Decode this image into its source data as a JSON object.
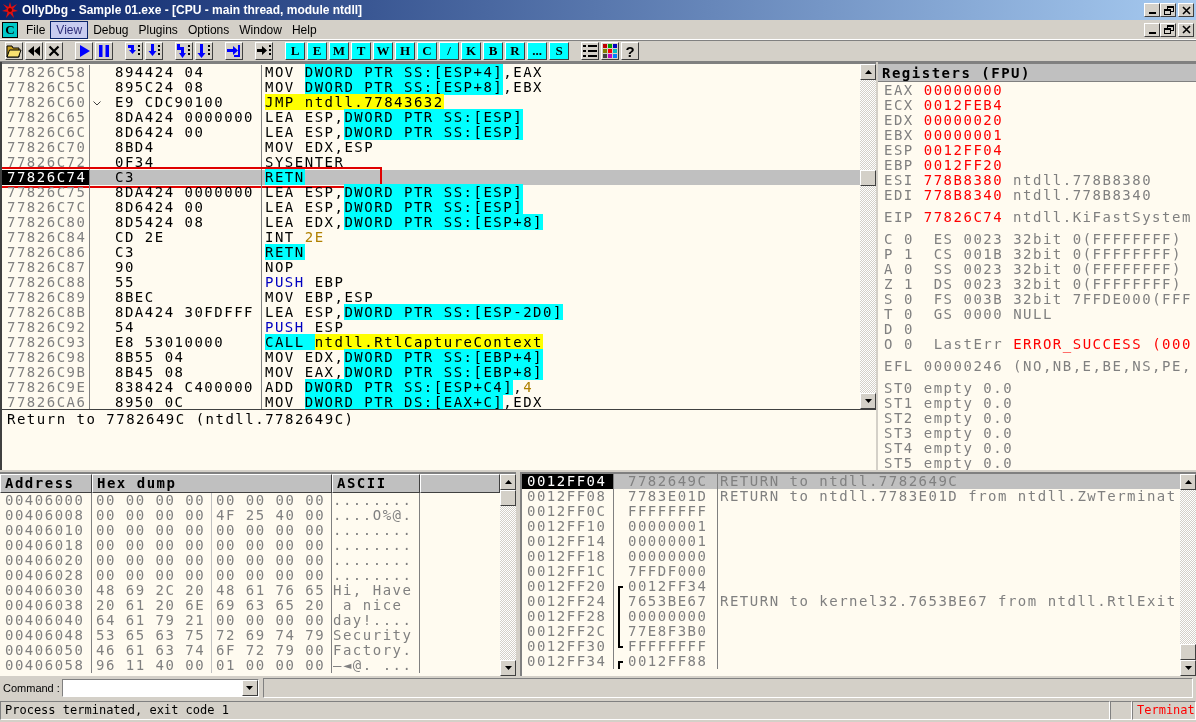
{
  "window": {
    "title": "OllyDbg - Sample 01.exe - [CPU - main thread, module ntdll]"
  },
  "menu": {
    "app_label": "C",
    "items": [
      {
        "label": "File",
        "selected": false
      },
      {
        "label": "View",
        "selected": true
      },
      {
        "label": "Debug",
        "selected": false
      },
      {
        "label": "Plugins",
        "selected": false
      },
      {
        "label": "Options",
        "selected": false
      },
      {
        "label": "Window",
        "selected": false
      },
      {
        "label": "Help",
        "selected": false
      }
    ]
  },
  "toolbar": [
    [
      {
        "kind": "open"
      },
      {
        "kind": "restart"
      },
      {
        "kind": "close"
      }
    ],
    [
      {
        "kind": "run"
      },
      {
        "kind": "pause"
      }
    ],
    [
      {
        "kind": "step_into"
      },
      {
        "kind": "step_over"
      }
    ],
    [
      {
        "kind": "trace_into"
      },
      {
        "kind": "trace_over"
      }
    ],
    [
      {
        "kind": "till_return"
      }
    ],
    [
      {
        "kind": "goto"
      }
    ],
    [
      {
        "kind": "letter",
        "label": "L"
      },
      {
        "kind": "letter",
        "label": "E"
      },
      {
        "kind": "letter",
        "label": "M"
      },
      {
        "kind": "letter",
        "label": "T"
      },
      {
        "kind": "letter",
        "label": "W"
      },
      {
        "kind": "letter",
        "label": "H"
      },
      {
        "kind": "letter",
        "label": "C"
      },
      {
        "kind": "letter",
        "label": "/"
      },
      {
        "kind": "letter",
        "label": "K"
      },
      {
        "kind": "letter",
        "label": "B"
      },
      {
        "kind": "letter",
        "label": "R"
      },
      {
        "kind": "letter",
        "label": "..."
      },
      {
        "kind": "letter",
        "label": "S"
      }
    ],
    [
      {
        "kind": "list"
      },
      {
        "kind": "colors"
      },
      {
        "kind": "help",
        "label": "?"
      }
    ]
  ],
  "disassembly": {
    "rows": [
      {
        "address": "77826C58",
        "hex": "894424 04",
        "jump": false,
        "selected": false,
        "outlined": false,
        "code": [
          {
            "text": "MOV ",
            "kind": "plain"
          },
          {
            "text": "DWORD PTR SS:[ESP+4]",
            "kind": "mem"
          },
          {
            "text": ",EAX",
            "kind": "plain"
          }
        ]
      },
      {
        "address": "77826C5C",
        "hex": "895C24 08",
        "jump": false,
        "selected": false,
        "outlined": false,
        "code": [
          {
            "text": "MOV ",
            "kind": "plain"
          },
          {
            "text": "DWORD PTR SS:[ESP+8]",
            "kind": "mem"
          },
          {
            "text": ",EBX",
            "kind": "plain"
          }
        ]
      },
      {
        "address": "77826C60",
        "hex": "E9 CDC90100",
        "jump": true,
        "selected": false,
        "outlined": false,
        "code": [
          {
            "text": "JMP ntdll.77843632",
            "kind": "target"
          }
        ]
      },
      {
        "address": "77826C65",
        "hex": "8DA424 0000000",
        "jump": false,
        "selected": false,
        "outlined": false,
        "code": [
          {
            "text": "LEA ESP,",
            "kind": "plain"
          },
          {
            "text": "DWORD PTR SS:[ESP]",
            "kind": "mem"
          }
        ]
      },
      {
        "address": "77826C6C",
        "hex": "8D6424 00",
        "jump": false,
        "selected": false,
        "outlined": false,
        "code": [
          {
            "text": "LEA ESP,",
            "kind": "plain"
          },
          {
            "text": "DWORD PTR SS:[ESP]",
            "kind": "mem"
          }
        ]
      },
      {
        "address": "77826C70",
        "hex": "8BD4",
        "jump": false,
        "selected": false,
        "outlined": false,
        "code": [
          {
            "text": "MOV EDX,ESP",
            "kind": "plain"
          }
        ]
      },
      {
        "address": "77826C72",
        "hex": "0F34",
        "jump": false,
        "selected": false,
        "outlined": false,
        "code": [
          {
            "text": "SYSENTER",
            "kind": "plain"
          }
        ]
      },
      {
        "address": "77826C74",
        "hex": "C3",
        "jump": false,
        "selected": true,
        "outlined": true,
        "code": [
          {
            "text": "RETN",
            "kind": "ret"
          }
        ]
      },
      {
        "address": "77826C75",
        "hex": "8DA424 0000000",
        "jump": false,
        "selected": false,
        "outlined": false,
        "code": [
          {
            "text": "LEA ESP,",
            "kind": "plain"
          },
          {
            "text": "DWORD PTR SS:[ESP]",
            "kind": "mem"
          }
        ]
      },
      {
        "address": "77826C7C",
        "hex": "8D6424 00",
        "jump": false,
        "selected": false,
        "outlined": false,
        "code": [
          {
            "text": "LEA ESP,",
            "kind": "plain"
          },
          {
            "text": "DWORD PTR SS:[ESP]",
            "kind": "mem"
          }
        ]
      },
      {
        "address": "77826C80",
        "hex": "8D5424 08",
        "jump": false,
        "selected": false,
        "outlined": false,
        "code": [
          {
            "text": "LEA EDX,",
            "kind": "plain"
          },
          {
            "text": "DWORD PTR SS:[ESP+8]",
            "kind": "mem"
          }
        ]
      },
      {
        "address": "77826C84",
        "hex": "CD 2E",
        "jump": false,
        "selected": false,
        "outlined": false,
        "code": [
          {
            "text": "INT ",
            "kind": "plain"
          },
          {
            "text": "2E",
            "kind": "num"
          }
        ]
      },
      {
        "address": "77826C86",
        "hex": "C3",
        "jump": false,
        "selected": false,
        "outlined": false,
        "code": [
          {
            "text": "RETN",
            "kind": "ret"
          }
        ]
      },
      {
        "address": "77826C87",
        "hex": "90",
        "jump": false,
        "selected": false,
        "outlined": false,
        "code": [
          {
            "text": "NOP",
            "kind": "plain"
          }
        ]
      },
      {
        "address": "77826C88",
        "hex": "55",
        "jump": false,
        "selected": false,
        "outlined": false,
        "code": [
          {
            "text": "PUSH",
            "kind": "push"
          },
          {
            "text": " EBP",
            "kind": "plain"
          }
        ]
      },
      {
        "address": "77826C89",
        "hex": "8BEC",
        "jump": false,
        "selected": false,
        "outlined": false,
        "code": [
          {
            "text": "MOV EBP,ESP",
            "kind": "plain"
          }
        ]
      },
      {
        "address": "77826C8B",
        "hex": "8DA424 30FDFFF",
        "jump": false,
        "selected": false,
        "outlined": false,
        "code": [
          {
            "text": "LEA ESP,",
            "kind": "plain"
          },
          {
            "text": "DWORD PTR SS:[ESP-2D0]",
            "kind": "mem"
          }
        ]
      },
      {
        "address": "77826C92",
        "hex": "54",
        "jump": false,
        "selected": false,
        "outlined": false,
        "code": [
          {
            "text": "PUSH",
            "kind": "push"
          },
          {
            "text": " ESP",
            "kind": "plain"
          }
        ]
      },
      {
        "address": "77826C93",
        "hex": "E8 53010000",
        "jump": false,
        "selected": false,
        "outlined": false,
        "code": [
          {
            "text": "CALL ",
            "kind": "ret"
          },
          {
            "text": "ntdll.RtlCaptureContext",
            "kind": "target"
          }
        ]
      },
      {
        "address": "77826C98",
        "hex": "8B55 04",
        "jump": false,
        "selected": false,
        "outlined": false,
        "code": [
          {
            "text": "MOV EDX,",
            "kind": "plain"
          },
          {
            "text": "DWORD PTR SS:[EBP+4]",
            "kind": "mem"
          }
        ]
      },
      {
        "address": "77826C9B",
        "hex": "8B45 08",
        "jump": false,
        "selected": false,
        "outlined": false,
        "code": [
          {
            "text": "MOV EAX,",
            "kind": "plain"
          },
          {
            "text": "DWORD PTR SS:[EBP+8]",
            "kind": "mem"
          }
        ]
      },
      {
        "address": "77826C9E",
        "hex": "838424 C400000",
        "jump": false,
        "selected": false,
        "outlined": false,
        "code": [
          {
            "text": "ADD ",
            "kind": "plain"
          },
          {
            "text": "DWORD PTR SS:[ESP+C4]",
            "kind": "mem"
          },
          {
            "text": ",",
            "kind": "plain"
          },
          {
            "text": "4",
            "kind": "num"
          }
        ]
      },
      {
        "address": "77826CA6",
        "hex": "8950 0C",
        "jump": false,
        "selected": false,
        "outlined": false,
        "code": [
          {
            "text": "MOV ",
            "kind": "plain"
          },
          {
            "text": "DWORD PTR DS:[EAX+C]",
            "kind": "mem"
          },
          {
            "text": ",EDX",
            "kind": "plain"
          }
        ]
      }
    ],
    "info": "Return to 7782649C (ntdll.7782649C)"
  },
  "registers": {
    "title": "Registers (FPU)",
    "general": [
      {
        "name": "EAX",
        "value": "00000000",
        "changed": true
      },
      {
        "name": "ECX",
        "value": "0012FEB4",
        "changed": true
      },
      {
        "name": "EDX",
        "value": "00000020",
        "changed": true
      },
      {
        "name": "EBX",
        "value": "00000001",
        "changed": true
      },
      {
        "name": "ESP",
        "value": "0012FF04",
        "changed": true
      },
      {
        "name": "EBP",
        "value": "0012FF20",
        "changed": true
      },
      {
        "name": "ESI",
        "value": "778B8380",
        "changed": true,
        "comment": "ntdll.778B8380"
      },
      {
        "name": "EDI",
        "value": "778B8340",
        "changed": true,
        "comment": "ntdll.778B8340"
      }
    ],
    "eip": {
      "name": "EIP",
      "value": "77826C74",
      "changed": true,
      "comment": "ntdll.KiFastSystem"
    },
    "flags": [
      {
        "flag": "C",
        "value": "0",
        "segment": "ES",
        "selector": "0023",
        "info": "32bit 0(FFFFFFFF)"
      },
      {
        "flag": "P",
        "value": "1",
        "segment": "CS",
        "selector": "001B",
        "info": "32bit 0(FFFFFFFF)"
      },
      {
        "flag": "A",
        "value": "0",
        "segment": "SS",
        "selector": "0023",
        "info": "32bit 0(FFFFFFFF)"
      },
      {
        "flag": "Z",
        "value": "1",
        "segment": "DS",
        "selector": "0023",
        "info": "32bit 0(FFFFFFFF)"
      },
      {
        "flag": "S",
        "value": "0",
        "segment": "FS",
        "selector": "003B",
        "info": "32bit 7FFDE000(FFF"
      },
      {
        "flag": "T",
        "value": "0",
        "segment": "GS",
        "selector": "0000",
        "info": "NULL"
      },
      {
        "flag": "D",
        "value": "0"
      },
      {
        "flag": "O",
        "value": "0"
      }
    ],
    "last_error": {
      "label": "LastErr",
      "value": "ERROR_SUCCESS (000"
    },
    "efl": {
      "name": "EFL",
      "value": "00000246",
      "changed": false,
      "comment": "(NO,NB,E,BE,NS,PE,"
    },
    "fpu": [
      {
        "name": "ST0",
        "tag": "empty",
        "value": "0.0"
      },
      {
        "name": "ST1",
        "tag": "empty",
        "value": "0.0"
      },
      {
        "name": "ST2",
        "tag": "empty",
        "value": "0.0"
      },
      {
        "name": "ST3",
        "tag": "empty",
        "value": "0.0"
      },
      {
        "name": "ST4",
        "tag": "empty",
        "value": "0.0"
      },
      {
        "name": "ST5",
        "tag": "empty",
        "value": "0.0"
      }
    ]
  },
  "dump": {
    "columns": [
      "Address",
      "Hex dump",
      "ASCII"
    ],
    "rows": [
      {
        "address": "00406000",
        "hex": [
          "00 00 00 00",
          "00 00 00 00"
        ],
        "ascii": "........"
      },
      {
        "address": "00406008",
        "hex": [
          "00 00 00 00",
          "4F 25 40 00"
        ],
        "ascii": "....O%@."
      },
      {
        "address": "00406010",
        "hex": [
          "00 00 00 00",
          "00 00 00 00"
        ],
        "ascii": "........"
      },
      {
        "address": "00406018",
        "hex": [
          "00 00 00 00",
          "00 00 00 00"
        ],
        "ascii": "........"
      },
      {
        "address": "00406020",
        "hex": [
          "00 00 00 00",
          "00 00 00 00"
        ],
        "ascii": "........"
      },
      {
        "address": "00406028",
        "hex": [
          "00 00 00 00",
          "00 00 00 00"
        ],
        "ascii": "........"
      },
      {
        "address": "00406030",
        "hex": [
          "48 69 2C 20",
          "48 61 76 65"
        ],
        "ascii": "Hi, Have"
      },
      {
        "address": "00406038",
        "hex": [
          "20 61 20 6E",
          "69 63 65 20"
        ],
        "ascii": " a nice "
      },
      {
        "address": "00406040",
        "hex": [
          "64 61 79 21",
          "00 00 00 00"
        ],
        "ascii": "day!...."
      },
      {
        "address": "00406048",
        "hex": [
          "53 65 63 75",
          "72 69 74 79"
        ],
        "ascii": "Security"
      },
      {
        "address": "00406050",
        "hex": [
          "46 61 63 74",
          "6F 72 79 00"
        ],
        "ascii": "Factory."
      },
      {
        "address": "00406058",
        "hex": [
          "96 11 40 00",
          "01 00 00 00"
        ],
        "ascii": "–◄@. ..."
      }
    ]
  },
  "stack": {
    "rows": [
      {
        "address": "0012FF04",
        "value": "7782649C",
        "comment": "RETURN to ntdll.7782649C",
        "selected": true,
        "kind": "plain"
      },
      {
        "address": "0012FF08",
        "value": "7783E01D",
        "comment": "RETURN to ntdll.7783E01D from ntdll.ZwTerminat",
        "selected": false,
        "kind": "plain"
      },
      {
        "address": "0012FF0C",
        "value": "FFFFFFFF",
        "selected": false,
        "kind": "plain"
      },
      {
        "address": "0012FF10",
        "value": "00000001",
        "selected": false,
        "kind": "plain"
      },
      {
        "address": "0012FF14",
        "value": "00000001",
        "selected": false,
        "kind": "plain"
      },
      {
        "address": "0012FF18",
        "value": "00000000",
        "selected": false,
        "kind": "plain"
      },
      {
        "address": "0012FF1C",
        "value": "7FFDF000",
        "selected": false,
        "kind": "plain"
      },
      {
        "address": "0012FF20",
        "value": "0012FF34",
        "selected": false,
        "kind": "frame_start"
      },
      {
        "address": "0012FF24",
        "value": "7653BE67",
        "comment": "RETURN to kernel32.7653BE67 from ntdll.RtlExit",
        "selected": false,
        "kind": "frame_mid"
      },
      {
        "address": "0012FF28",
        "value": "00000000",
        "selected": false,
        "kind": "frame_mid"
      },
      {
        "address": "0012FF2C",
        "value": "77E8F3B0",
        "selected": false,
        "kind": "frame_mid"
      },
      {
        "address": "0012FF30",
        "value": "FFFFFFFF",
        "selected": false,
        "kind": "frame_end"
      },
      {
        "address": "0012FF34",
        "value": "0012FF88",
        "selected": false,
        "kind": "frame_start"
      }
    ]
  },
  "command": {
    "label": "Command :"
  },
  "status_bar": {
    "message": "Process terminated, exit code 1",
    "state": "Terminat"
  }
}
